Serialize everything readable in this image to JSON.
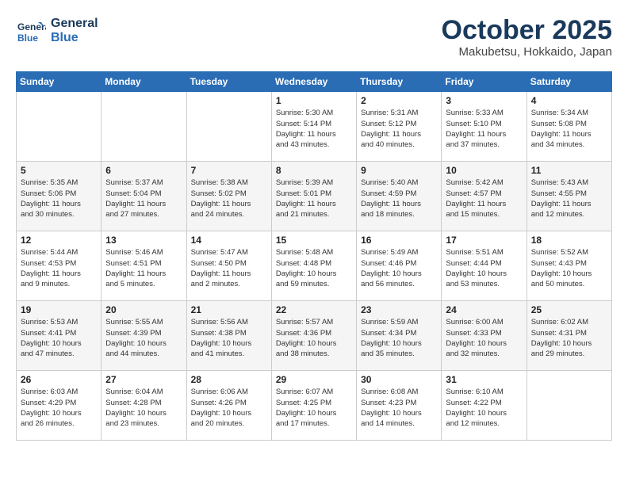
{
  "header": {
    "logo_line1": "General",
    "logo_line2": "Blue",
    "month_title": "October 2025",
    "location": "Makubetsu, Hokkaido, Japan"
  },
  "weekdays": [
    "Sunday",
    "Monday",
    "Tuesday",
    "Wednesday",
    "Thursday",
    "Friday",
    "Saturday"
  ],
  "weeks": [
    [
      {
        "day": "",
        "info": ""
      },
      {
        "day": "",
        "info": ""
      },
      {
        "day": "",
        "info": ""
      },
      {
        "day": "1",
        "info": "Sunrise: 5:30 AM\nSunset: 5:14 PM\nDaylight: 11 hours\nand 43 minutes."
      },
      {
        "day": "2",
        "info": "Sunrise: 5:31 AM\nSunset: 5:12 PM\nDaylight: 11 hours\nand 40 minutes."
      },
      {
        "day": "3",
        "info": "Sunrise: 5:33 AM\nSunset: 5:10 PM\nDaylight: 11 hours\nand 37 minutes."
      },
      {
        "day": "4",
        "info": "Sunrise: 5:34 AM\nSunset: 5:08 PM\nDaylight: 11 hours\nand 34 minutes."
      }
    ],
    [
      {
        "day": "5",
        "info": "Sunrise: 5:35 AM\nSunset: 5:06 PM\nDaylight: 11 hours\nand 30 minutes."
      },
      {
        "day": "6",
        "info": "Sunrise: 5:37 AM\nSunset: 5:04 PM\nDaylight: 11 hours\nand 27 minutes."
      },
      {
        "day": "7",
        "info": "Sunrise: 5:38 AM\nSunset: 5:02 PM\nDaylight: 11 hours\nand 24 minutes."
      },
      {
        "day": "8",
        "info": "Sunrise: 5:39 AM\nSunset: 5:01 PM\nDaylight: 11 hours\nand 21 minutes."
      },
      {
        "day": "9",
        "info": "Sunrise: 5:40 AM\nSunset: 4:59 PM\nDaylight: 11 hours\nand 18 minutes."
      },
      {
        "day": "10",
        "info": "Sunrise: 5:42 AM\nSunset: 4:57 PM\nDaylight: 11 hours\nand 15 minutes."
      },
      {
        "day": "11",
        "info": "Sunrise: 5:43 AM\nSunset: 4:55 PM\nDaylight: 11 hours\nand 12 minutes."
      }
    ],
    [
      {
        "day": "12",
        "info": "Sunrise: 5:44 AM\nSunset: 4:53 PM\nDaylight: 11 hours\nand 9 minutes."
      },
      {
        "day": "13",
        "info": "Sunrise: 5:46 AM\nSunset: 4:51 PM\nDaylight: 11 hours\nand 5 minutes."
      },
      {
        "day": "14",
        "info": "Sunrise: 5:47 AM\nSunset: 4:50 PM\nDaylight: 11 hours\nand 2 minutes."
      },
      {
        "day": "15",
        "info": "Sunrise: 5:48 AM\nSunset: 4:48 PM\nDaylight: 10 hours\nand 59 minutes."
      },
      {
        "day": "16",
        "info": "Sunrise: 5:49 AM\nSunset: 4:46 PM\nDaylight: 10 hours\nand 56 minutes."
      },
      {
        "day": "17",
        "info": "Sunrise: 5:51 AM\nSunset: 4:44 PM\nDaylight: 10 hours\nand 53 minutes."
      },
      {
        "day": "18",
        "info": "Sunrise: 5:52 AM\nSunset: 4:43 PM\nDaylight: 10 hours\nand 50 minutes."
      }
    ],
    [
      {
        "day": "19",
        "info": "Sunrise: 5:53 AM\nSunset: 4:41 PM\nDaylight: 10 hours\nand 47 minutes."
      },
      {
        "day": "20",
        "info": "Sunrise: 5:55 AM\nSunset: 4:39 PM\nDaylight: 10 hours\nand 44 minutes."
      },
      {
        "day": "21",
        "info": "Sunrise: 5:56 AM\nSunset: 4:38 PM\nDaylight: 10 hours\nand 41 minutes."
      },
      {
        "day": "22",
        "info": "Sunrise: 5:57 AM\nSunset: 4:36 PM\nDaylight: 10 hours\nand 38 minutes."
      },
      {
        "day": "23",
        "info": "Sunrise: 5:59 AM\nSunset: 4:34 PM\nDaylight: 10 hours\nand 35 minutes."
      },
      {
        "day": "24",
        "info": "Sunrise: 6:00 AM\nSunset: 4:33 PM\nDaylight: 10 hours\nand 32 minutes."
      },
      {
        "day": "25",
        "info": "Sunrise: 6:02 AM\nSunset: 4:31 PM\nDaylight: 10 hours\nand 29 minutes."
      }
    ],
    [
      {
        "day": "26",
        "info": "Sunrise: 6:03 AM\nSunset: 4:29 PM\nDaylight: 10 hours\nand 26 minutes."
      },
      {
        "day": "27",
        "info": "Sunrise: 6:04 AM\nSunset: 4:28 PM\nDaylight: 10 hours\nand 23 minutes."
      },
      {
        "day": "28",
        "info": "Sunrise: 6:06 AM\nSunset: 4:26 PM\nDaylight: 10 hours\nand 20 minutes."
      },
      {
        "day": "29",
        "info": "Sunrise: 6:07 AM\nSunset: 4:25 PM\nDaylight: 10 hours\nand 17 minutes."
      },
      {
        "day": "30",
        "info": "Sunrise: 6:08 AM\nSunset: 4:23 PM\nDaylight: 10 hours\nand 14 minutes."
      },
      {
        "day": "31",
        "info": "Sunrise: 6:10 AM\nSunset: 4:22 PM\nDaylight: 10 hours\nand 12 minutes."
      },
      {
        "day": "",
        "info": ""
      }
    ]
  ]
}
